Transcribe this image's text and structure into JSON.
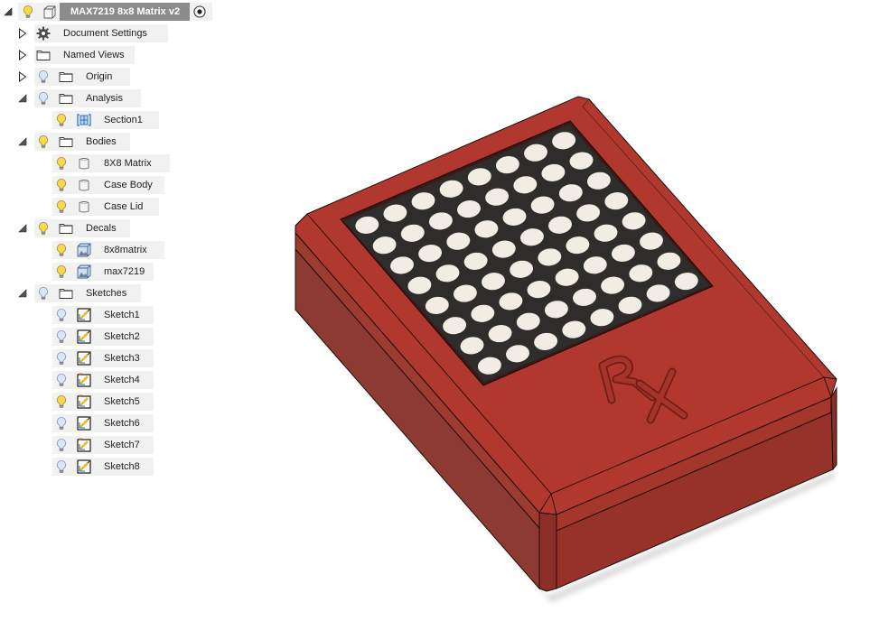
{
  "browser": {
    "root": {
      "label": "MAX7219 8x8 Matrix v2",
      "expanded": true,
      "light": "on",
      "icon": "component-icon",
      "active_indicator": "radio-active-icon"
    },
    "nodes": [
      {
        "id": "document-settings",
        "label": "Document Settings",
        "level": 1,
        "toggle": "collapsed",
        "light": null,
        "icon": "gear-icon"
      },
      {
        "id": "named-views",
        "label": "Named Views",
        "level": 1,
        "toggle": "collapsed",
        "light": null,
        "icon": "folder-icon"
      },
      {
        "id": "origin",
        "label": "Origin",
        "level": 1,
        "toggle": "collapsed",
        "light": "off",
        "icon": "folder-icon"
      },
      {
        "id": "analysis",
        "label": "Analysis",
        "level": 1,
        "toggle": "expanded",
        "light": "off",
        "icon": "folder-icon"
      },
      {
        "id": "section1",
        "label": "Section1",
        "level": 2,
        "toggle": null,
        "light": "on",
        "icon": "section-analysis-icon"
      },
      {
        "id": "bodies",
        "label": "Bodies",
        "level": 1,
        "toggle": "expanded",
        "light": "on",
        "icon": "folder-icon"
      },
      {
        "id": "body-8x8-matrix",
        "label": "8X8 Matrix",
        "level": 2,
        "toggle": null,
        "light": "on",
        "icon": "body-icon"
      },
      {
        "id": "body-case-body",
        "label": "Case Body",
        "level": 2,
        "toggle": null,
        "light": "on",
        "icon": "body-icon"
      },
      {
        "id": "body-case-lid",
        "label": "Case Lid",
        "level": 2,
        "toggle": null,
        "light": "on",
        "icon": "body-icon"
      },
      {
        "id": "decals",
        "label": "Decals",
        "level": 1,
        "toggle": "expanded",
        "light": "on",
        "icon": "folder-icon"
      },
      {
        "id": "decal-8x8matrix",
        "label": "8x8matrix",
        "level": 2,
        "toggle": null,
        "light": "on",
        "icon": "decal-icon"
      },
      {
        "id": "decal-max7219",
        "label": "max7219",
        "level": 2,
        "toggle": null,
        "light": "on",
        "icon": "decal-icon"
      },
      {
        "id": "sketches",
        "label": "Sketches",
        "level": 1,
        "toggle": "expanded",
        "light": "off",
        "icon": "folder-icon"
      },
      {
        "id": "sketch1",
        "label": "Sketch1",
        "level": 2,
        "toggle": null,
        "light": "off",
        "icon": "sketch-icon"
      },
      {
        "id": "sketch2",
        "label": "Sketch2",
        "level": 2,
        "toggle": null,
        "light": "off",
        "icon": "sketch-icon"
      },
      {
        "id": "sketch3",
        "label": "Sketch3",
        "level": 2,
        "toggle": null,
        "light": "off",
        "icon": "sketch-icon"
      },
      {
        "id": "sketch4",
        "label": "Sketch4",
        "level": 2,
        "toggle": null,
        "light": "off",
        "icon": "sketch-warning-icon"
      },
      {
        "id": "sketch5",
        "label": "Sketch5",
        "level": 2,
        "toggle": null,
        "light": "on",
        "icon": "sketch-warning-icon"
      },
      {
        "id": "sketch6",
        "label": "Sketch6",
        "level": 2,
        "toggle": null,
        "light": "off",
        "icon": "sketch-icon"
      },
      {
        "id": "sketch7",
        "label": "Sketch7",
        "level": 2,
        "toggle": null,
        "light": "off",
        "icon": "sketch-warning-icon"
      },
      {
        "id": "sketch8",
        "label": "Sketch8",
        "level": 2,
        "toggle": null,
        "light": "off",
        "icon": "sketch-icon"
      }
    ]
  },
  "model": {
    "name": "8x8 LED matrix case",
    "engraving": "Rx",
    "led_grid": {
      "rows": 8,
      "cols": 8
    },
    "colors": {
      "case_top": "#b0382e",
      "case_side_left": "#8f3a32",
      "case_side_right": "#98352d",
      "matrix_panel": "#2e2d2b",
      "led": "#f1ede4",
      "edge_line": "#1a0c0a",
      "selection": "#8c8c8c",
      "row_bg": "#f1f1f1",
      "bulb_on": "#f7d94c",
      "bulb_off": "#cfdcf2"
    }
  }
}
